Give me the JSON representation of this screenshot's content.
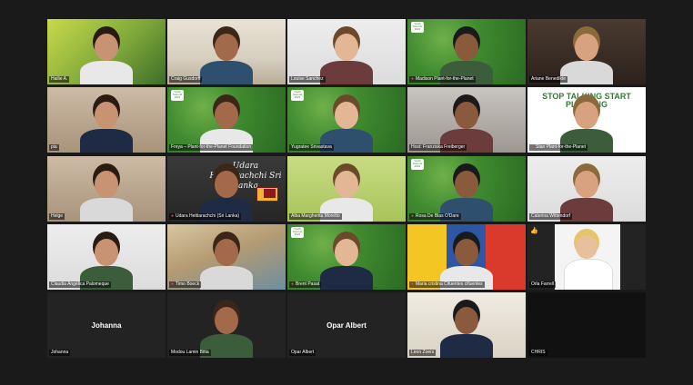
{
  "meeting": {
    "rows": [
      [
        {
          "name": "Hailie A.",
          "bg": "yellow",
          "muted": false,
          "badge": false,
          "speaking": false
        },
        {
          "name": "Craig Gusdorff",
          "bg": "office",
          "muted": false,
          "badge": false,
          "speaking": true
        },
        {
          "name": "Louise Sanchez",
          "bg": "white",
          "muted": false,
          "badge": false,
          "speaking": false
        },
        {
          "name": "Madison Plant-for-the-Planet",
          "bg": "leaves",
          "muted": true,
          "badge": true,
          "speaking": false
        },
        {
          "name": "Ariane Benedikte",
          "bg": "dark",
          "muted": false,
          "badge": false,
          "speaking": false
        }
      ],
      [
        {
          "name": "pia",
          "bg": "room",
          "muted": false,
          "badge": false,
          "speaking": false
        },
        {
          "name": "Freya – Plant-for-the-Planet Foundation",
          "bg": "leaves",
          "muted": false,
          "badge": true,
          "speaking": false
        },
        {
          "name": "Yugratee Srivastava",
          "bg": "leaves",
          "muted": false,
          "badge": true,
          "speaking": false
        },
        {
          "name": "Host: Franziska Freiberger",
          "bg": "grey",
          "muted": false,
          "badge": false,
          "speaking": false
        },
        {
          "name": "Stan Plant-for-the-Planet",
          "bg": "poster",
          "muted": true,
          "badge": false,
          "speaking": false
        }
      ],
      [
        {
          "name": "Helge",
          "bg": "room",
          "muted": false,
          "badge": false,
          "speaking": false
        },
        {
          "name": "Udara Hettiarachchi (Sri Lanka)",
          "bg": "chalk",
          "muted": true,
          "badge": false,
          "speaking": false
        },
        {
          "name": "Alba Margherita Moretto",
          "bg": "lime",
          "muted": false,
          "badge": false,
          "speaking": false
        },
        {
          "name": "Rosa De Blas O'Dare",
          "bg": "leaves",
          "muted": true,
          "badge": true,
          "speaking": false
        },
        {
          "name": "Caterina Wittendorf",
          "bg": "white",
          "muted": false,
          "badge": false,
          "speaking": false
        }
      ],
      [
        {
          "name": "Claudia Angélica Palomeque",
          "bg": "white",
          "muted": false,
          "badge": false,
          "speaking": false
        },
        {
          "name": "Timo Boeck",
          "bg": "beach",
          "muted": true,
          "badge": false,
          "speaking": false
        },
        {
          "name": "Brent Pasat",
          "bg": "leaves",
          "muted": true,
          "badge": true,
          "speaking": false
        },
        {
          "name": "Maria cristina Cifuentes cifuentes",
          "bg": "flag",
          "muted": true,
          "badge": false,
          "speaking": false
        },
        {
          "name": "Orla Farrell",
          "bg": "solid",
          "muted": false,
          "badge": false,
          "speaking": false,
          "raised_hand": true
        }
      ],
      [
        {
          "name": "Johanna",
          "bg": "solid",
          "muted": false,
          "badge": false,
          "speaking": false,
          "label": "Johanna"
        },
        {
          "name": "Modou Lamin Bitta",
          "bg": "solid",
          "muted": false,
          "badge": false,
          "speaking": false
        },
        {
          "name": "Opar Albert",
          "bg": "solid",
          "muted": false,
          "badge": false,
          "speaking": false,
          "label": "Opar Albert"
        },
        {
          "name": "Leon Zoers",
          "bg": "cream",
          "muted": false,
          "badge": false,
          "speaking": false
        },
        {
          "name": "CHRIS",
          "bg": "black",
          "muted": false,
          "badge": false,
          "speaking": false
        }
      ]
    ],
    "badge_text": "Youth Summit 2021",
    "poster_text": "STOP TALKING START PLANTING",
    "chalk_title": "Udara Hettiarachchi Sri Lanka",
    "colors": {
      "background": "#1a1a1a",
      "speaking_outline": "#f2d03c",
      "muted_icon": "#e5484d"
    }
  }
}
